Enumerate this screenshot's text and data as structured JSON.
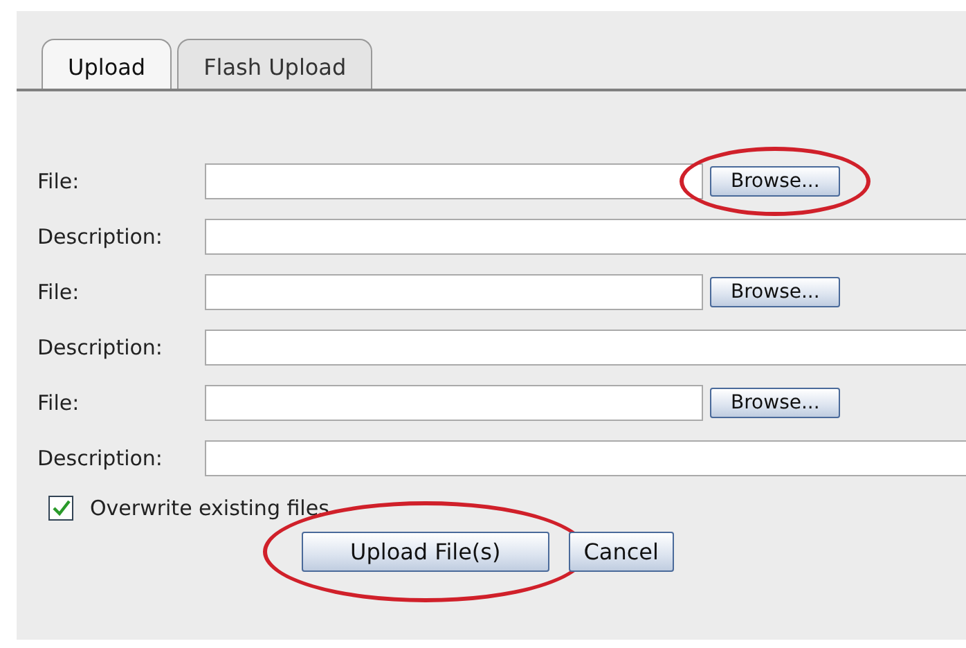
{
  "tabs": [
    {
      "label": "Upload",
      "selected": true
    },
    {
      "label": "Flash Upload",
      "selected": false
    }
  ],
  "rows": [
    {
      "kind": "file",
      "label": "File:",
      "button": "Browse...",
      "highlighted": true
    },
    {
      "kind": "description",
      "label": "Description:"
    },
    {
      "kind": "file",
      "label": "File:",
      "button": "Browse...",
      "highlighted": false
    },
    {
      "kind": "description",
      "label": "Description:"
    },
    {
      "kind": "file",
      "label": "File:",
      "button": "Browse...",
      "highlighted": false
    },
    {
      "kind": "description",
      "label": "Description:"
    }
  ],
  "overwrite": {
    "label": "Overwrite existing files",
    "checked": true
  },
  "buttons": [
    {
      "label": "Upload File(s)",
      "highlighted": true
    },
    {
      "label": "Cancel",
      "highlighted": false
    }
  ]
}
